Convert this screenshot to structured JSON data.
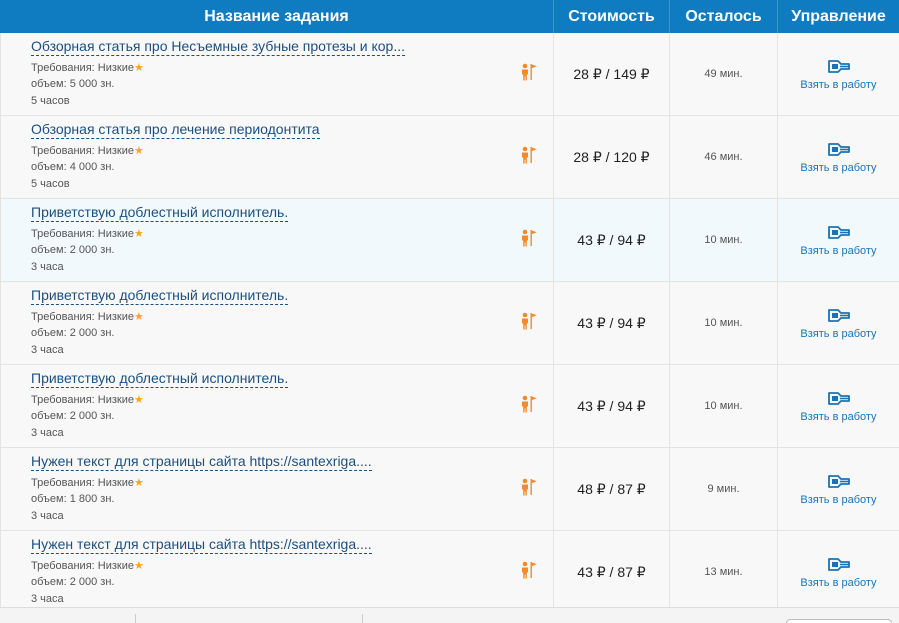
{
  "header": {
    "title_col": "Название задания",
    "cost_col": "Стоимость",
    "left_col": "Осталось",
    "manage_col": "Управление"
  },
  "colors": {
    "header_bg": "#0f7cc2",
    "link": "#1c4f7e",
    "accent": "#f5a623",
    "icon": "#f08a2c",
    "action": "#1a73b5"
  },
  "icons": {
    "person": "person-with-flag-icon",
    "take": "take-task-icon",
    "star": "star-icon"
  },
  "rows": [
    {
      "title": "Обзорная статья про Несъемные зубные протезы и кор...",
      "req": "Требования: Низкие",
      "volume": "объем: 5 000 зн.",
      "duration": "5 часов",
      "cost": "28 ₽ / 149 ₽",
      "left": "49 мин.",
      "action": "Взять в работу"
    },
    {
      "title": "Обзорная статья про лечение периодонтита",
      "req": "Требования: Низкие",
      "volume": "объем: 4 000 зн.",
      "duration": "5 часов",
      "cost": "28 ₽ / 120 ₽",
      "left": "46 мин.",
      "action": "Взять в работу"
    },
    {
      "title": "Приветствую доблестный исполнитель.",
      "req": "Требования: Низкие",
      "volume": "объем: 2 000 зн.",
      "duration": "3 часа",
      "cost": "43 ₽ / 94 ₽",
      "left": "10 мин.",
      "action": "Взять в работу"
    },
    {
      "title": "Приветствую доблестный исполнитель.",
      "req": "Требования: Низкие",
      "volume": "объем: 2 000 зн.",
      "duration": "3 часа",
      "cost": "43 ₽ / 94 ₽",
      "left": "10 мин.",
      "action": "Взять в работу"
    },
    {
      "title": "Приветствую доблестный исполнитель.",
      "req": "Требования: Низкие",
      "volume": "объем: 2 000 зн.",
      "duration": "3 часа",
      "cost": "43 ₽ / 94 ₽",
      "left": "10 мин.",
      "action": "Взять в работу"
    },
    {
      "title": "Нужен текст для страницы сайта https://santexriga....",
      "req": "Требования: Низкие",
      "volume": "объем: 1 800 зн.",
      "duration": "3 часа",
      "cost": "48 ₽ / 87 ₽",
      "left": "9 мин.",
      "action": "Взять в работу"
    },
    {
      "title": "Нужен текст для страницы сайта https://santexriga....",
      "req": "Требования: Низкие",
      "volume": "объем: 2 000 зн.",
      "duration": "3 часа",
      "cost": "43 ₽ / 87 ₽",
      "left": "13 мин.",
      "action": "Взять в работу"
    }
  ]
}
